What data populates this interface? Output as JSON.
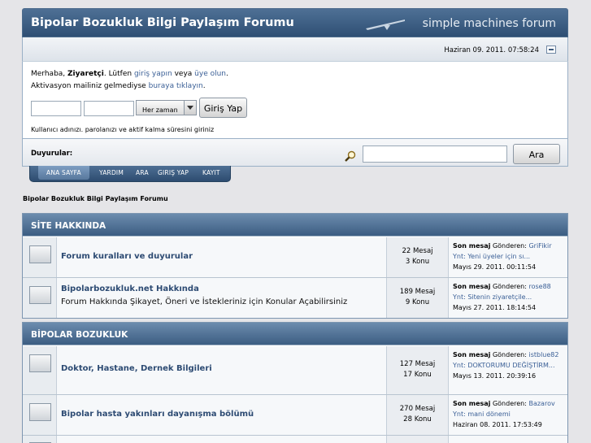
{
  "header": {
    "title": "Bipolar Bozukluk Bilgi Paylaşım Forumu",
    "brand": "simple machines forum"
  },
  "datebar": {
    "date": "Haziran 09. 2011. 07:58:24"
  },
  "login": {
    "greet_prefix": "Merhaba,",
    "guest": "Ziyaretçi",
    "please": ". Lütfen",
    "login_link": "giriş yapın",
    "or": "veya",
    "register_link": "üye olun",
    "activation_text": "Aktivasyon mailiniz gelmediyse",
    "activation_link": "buraya tıklayın",
    "duration_select": "Her zaman",
    "login_button": "Giriş Yap",
    "hint": "Kullanıcı adınızı. parolanızı ve aktif kalma süresini giriniz"
  },
  "search": {
    "announcements_label": "Duyurular:",
    "button": "Ara"
  },
  "tabs": [
    "ANA SAYFA",
    "YARDIM",
    "ARA",
    "GIRIŞ YAP",
    "KAYIT"
  ],
  "breadcrumb": "Bipolar Bozukluk Bilgi Paylaşım Forumu",
  "categories": [
    {
      "name": "SİTE HAKKINDA",
      "boards": [
        {
          "name": "Forum kuralları ve duyurular",
          "desc": "",
          "posts": "22 Mesaj",
          "topics": "3 Konu",
          "last_label": "Son mesaj",
          "by": "Gönderen:",
          "user": "GriFikir",
          "subject": "Ynt: Yeni üyeler için sı...",
          "date": "Mayıs 29. 2011. 00:11:54"
        },
        {
          "name": "Bipolarbozukluk.net Hakkında",
          "desc": "Forum Hakkında Şikayet, Öneri ve İstekleriniz için Konular Açabilirsiniz",
          "posts": "189 Mesaj",
          "topics": "9 Konu",
          "last_label": "Son mesaj",
          "by": "Gönderen:",
          "user": "rose88",
          "subject": "Ynt: Sitenin ziyaretçile...",
          "date": "Mayıs 27. 2011. 18:14:54"
        }
      ]
    },
    {
      "name": "BİPOLAR BOZUKLUK",
      "boards": [
        {
          "name": "Doktor, Hastane, Dernek Bilgileri",
          "desc": "",
          "posts": "127 Mesaj",
          "topics": "17 Konu",
          "last_label": "Son mesaj",
          "by": "Gönderen:",
          "user": "istblue82",
          "subject": "Ynt: DOKTORUMU DEĞİŞTİRM...",
          "date": "Mayıs 13. 2011. 20:39:16"
        },
        {
          "name": "Bipolar hasta yakınları dayanışma bölümü",
          "desc": "",
          "posts": "270 Mesaj",
          "topics": "28 Konu",
          "last_label": "Son mesaj",
          "by": "Gönderen:",
          "user": "Bazarov",
          "subject": "Ynt: mani dönemi",
          "date": "Haziran 08. 2011. 17:53:49"
        }
      ]
    }
  ]
}
